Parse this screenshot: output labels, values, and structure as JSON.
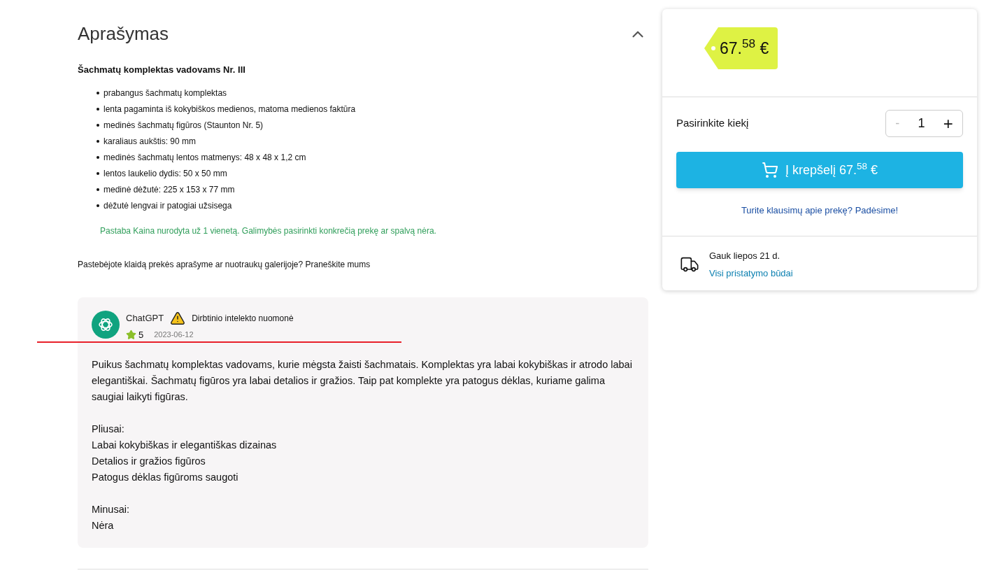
{
  "description": {
    "title": "Aprašymas",
    "expanded": true,
    "product_name": "Šachmatų komplektas vadovams Nr. III",
    "features": [
      "prabangus šachmatų komplektas",
      "lenta pagaminta iš kokybiškos medienos, matoma medienos faktūra",
      "medinės šachmatų figūros (Staunton Nr. 5)",
      "karaliaus aukštis: 90 mm",
      "medinės šachmatų lentos matmenys: 48 x 48 x 1,2 cm",
      "lentos laukelio dydis: 50 x 50 mm",
      "medinė dėžutė: 225 x 153 x 77 mm",
      "dėžutė lengvai ir patogiai užsisega"
    ],
    "note": "Pastaba Kaina nurodyta už 1 vienetą. Galimybės pasirinkti konkrečią prekę ar spalvą nėra.",
    "report_text": "Pastebėjote klaidą prekės aprašyme ar nuotraukų galerijoje? Praneškite mums"
  },
  "review": {
    "author": "ChatGPT",
    "badge": "Dirbtinio intelekto nuomonė",
    "rating": "5",
    "date": "2023-06-12",
    "paragraphs": [
      [
        "Puikus šachmatų komplektas vadovams, kurie mėgsta žaisti šachmatais. Komplektas yra labai kokybiškas ir atrodo labai elegantiškai. Šachmatų figūros yra labai detalios ir gražios. Taip pat komplekte yra patogus dėklas, kuriame galima saugiai laikyti figūras."
      ],
      [
        "Pliusai:",
        "Labai kokybiškas ir elegantiškas dizainas",
        "Detalios ir gražios figūros",
        "Patogus dėklas figūroms saugoti"
      ],
      [
        "Minusai:",
        "Nėra"
      ]
    ]
  },
  "purchase": {
    "price": "67.$^{58}$ €",
    "quantity_label": "Pasirinkite kiekį",
    "quantity": "1",
    "minus": "-",
    "plus": "+",
    "cart_button": "Į krepšelį 67.$^{58}$ €",
    "help_link": "Turite klausimų apie prekę? Padėsime!",
    "delivery": "Gauk liepos 21 d.",
    "delivery_link": "Visi pristatymo būdai"
  }
}
